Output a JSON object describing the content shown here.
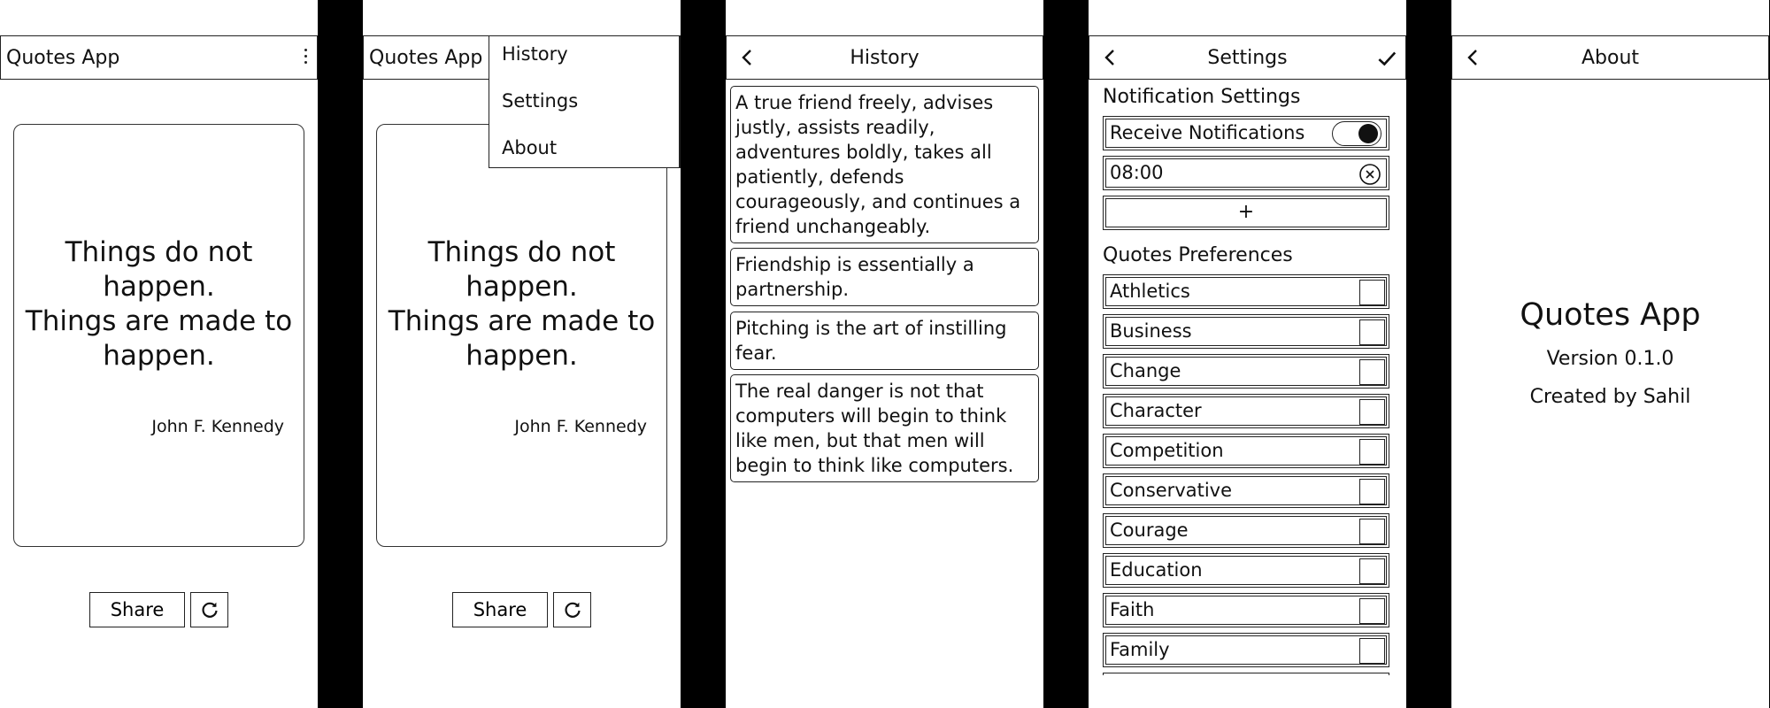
{
  "home": {
    "title": "Quotes App",
    "quote_lines": "Things do not\nhappen.\nThings are made to\nhappen.",
    "author": "John F. Kennedy",
    "share_label": "Share",
    "more_icon": "more-vert-icon",
    "refresh_icon": "refresh-icon"
  },
  "menu": {
    "items": [
      {
        "label": "History"
      },
      {
        "label": "Settings"
      },
      {
        "label": "About"
      }
    ]
  },
  "history": {
    "title": "History",
    "back_icon": "back-arrow-icon",
    "quotes": [
      {
        "text": "A true friend freely, advises justly, assists readily, adventures boldly, takes all patiently, defends courageously, and continues a friend unchangeably."
      },
      {
        "text": "Friendship is essentially a partnership."
      },
      {
        "text": "Pitching is the art of instilling fear."
      },
      {
        "text": "The real danger is not that computers will begin to think like men, but that men will begin to think like computers."
      }
    ]
  },
  "settings": {
    "title": "Settings",
    "confirm_icon": "check-icon",
    "notification_section": "Notification Settings",
    "receive_label": "Receive Notifications",
    "receive_enabled": true,
    "time_value": "08:00",
    "add_label": "+",
    "preferences_section": "Quotes Preferences",
    "categories": [
      {
        "label": "Athletics",
        "checked": false
      },
      {
        "label": "Business",
        "checked": false
      },
      {
        "label": "Change",
        "checked": false
      },
      {
        "label": "Character",
        "checked": false
      },
      {
        "label": "Competition",
        "checked": false
      },
      {
        "label": "Conservative",
        "checked": false
      },
      {
        "label": "Courage",
        "checked": false
      },
      {
        "label": "Education",
        "checked": false
      },
      {
        "label": "Faith",
        "checked": false
      },
      {
        "label": "Family",
        "checked": false
      }
    ]
  },
  "about": {
    "title": "About",
    "app_name": "Quotes App",
    "version": "Version 0.1.0",
    "credit": "Created by Sahil"
  }
}
